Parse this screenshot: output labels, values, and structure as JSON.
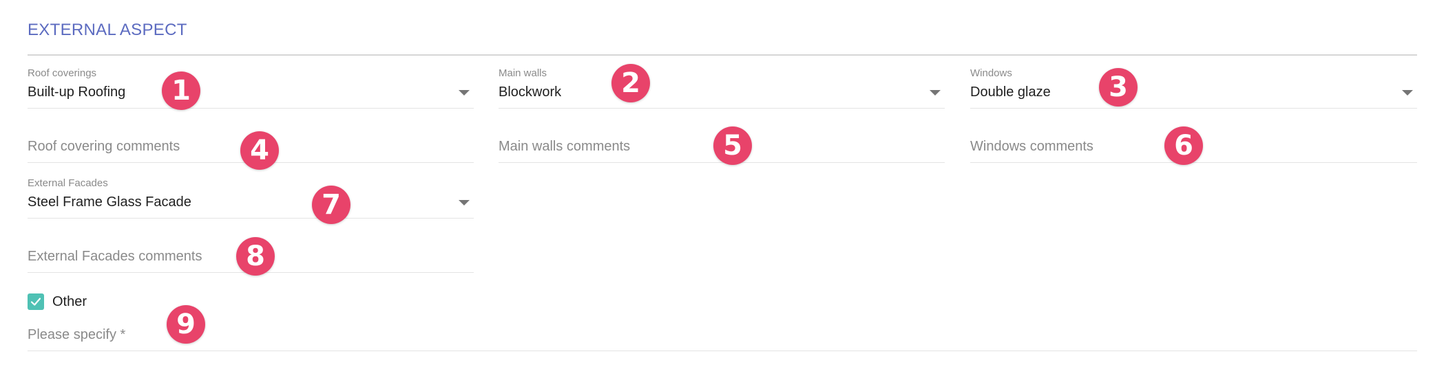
{
  "section": {
    "title": "EXTERNAL ASPECT"
  },
  "fields": {
    "roof_coverings": {
      "label": "Roof coverings",
      "value": "Built-up Roofing"
    },
    "main_walls": {
      "label": "Main walls",
      "value": "Blockwork"
    },
    "windows": {
      "label": "Windows",
      "value": "Double glaze"
    },
    "roof_covering_comments": {
      "placeholder": "Roof covering comments"
    },
    "main_walls_comments": {
      "placeholder": "Main walls comments"
    },
    "windows_comments": {
      "placeholder": "Windows comments"
    },
    "external_facades": {
      "label": "External Facades",
      "value": "Steel Frame Glass Facade"
    },
    "external_facades_comments": {
      "placeholder": "External Facades comments"
    },
    "other": {
      "label": "Other",
      "checked": true
    },
    "please_specify": {
      "placeholder": "Please specify *"
    }
  },
  "badges": [
    "1",
    "2",
    "3",
    "4",
    "5",
    "6",
    "7",
    "8",
    "9"
  ],
  "colors": {
    "title": "#5c6bc0",
    "badge": "#e8436a",
    "checkbox": "#4fc1b4"
  },
  "icons": {
    "dropdown": "caret-down-icon",
    "check": "check-icon"
  }
}
